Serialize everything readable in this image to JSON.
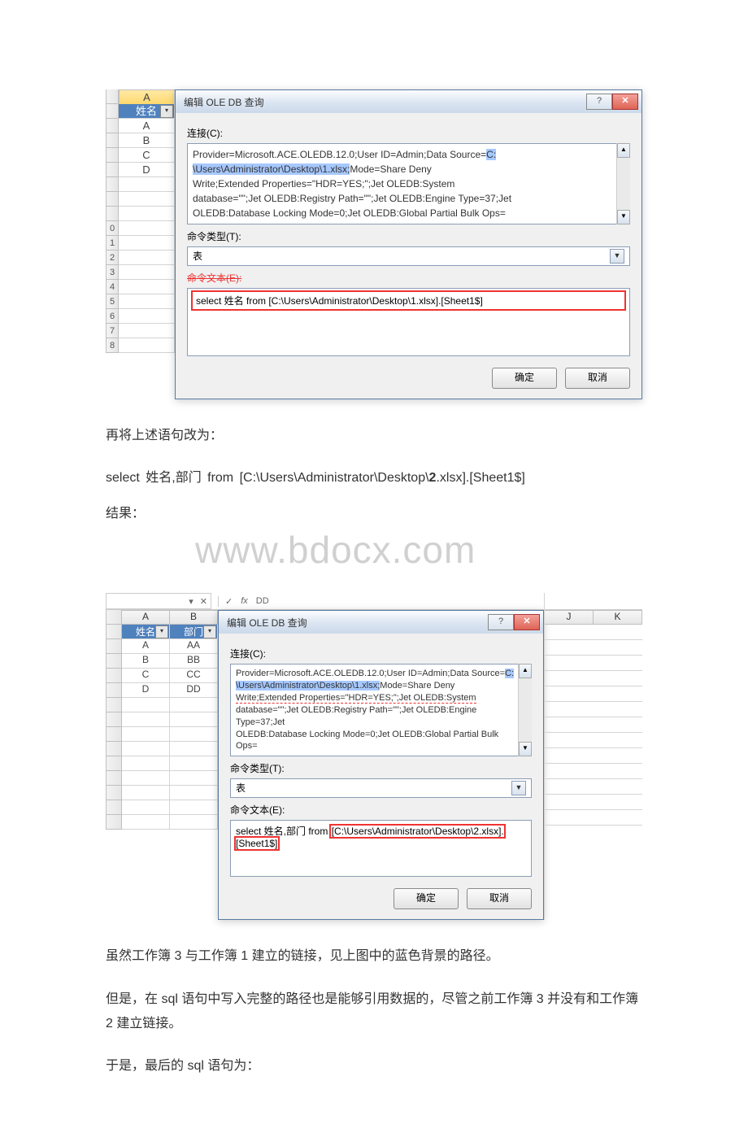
{
  "screenshot1": {
    "col_header": "A",
    "header_cell": "姓名",
    "rows": [
      "A",
      "B",
      "C",
      "D"
    ],
    "row_numbers": [
      "",
      "",
      "",
      "",
      "",
      "",
      "",
      "",
      "",
      "0",
      "1",
      "2",
      "3",
      "4",
      "5",
      "6",
      "7",
      "8"
    ],
    "dialog": {
      "title": "编辑 OLE DB 查询",
      "help_btn": "?",
      "close_btn": "✕",
      "conn_label": "连接(C):",
      "conn_text_pre": "Provider=Microsoft.ACE.OLEDB.12.0;User ID=Admin;Data Source=",
      "conn_hl1": "C:",
      "conn_line2_hl": "\\Users\\Administrator\\Desktop\\1.xlsx;",
      "conn_line2_rest": "Mode=Share Deny",
      "conn_line3": "Write;Extended Properties=\"HDR=YES;\";Jet OLEDB:System",
      "conn_line4": "database=\"\";Jet OLEDB:Registry Path=\"\";Jet OLEDB:Engine Type=37;Jet",
      "conn_line5": "OLEDB:Database Locking Mode=0;Jet OLEDB:Global Partial Bulk Ops=",
      "cmdtype_label": "命令类型(T):",
      "cmdtype_value": "表",
      "cmdtext_label_strike": "命令文本(E):",
      "sql": "select 姓名 from   [C:\\Users\\Administrator\\Desktop\\1.xlsx].[Sheet1$]",
      "ok": "确定",
      "cancel": "取消"
    }
  },
  "body": {
    "p1": "再将上述语句改为：",
    "code_pre": "select  姓名,部门  from    [C:\\Users\\Administrator\\Desktop\\",
    "code_bold": "2",
    "code_post": ".xlsx].[Sheet1$]",
    "result_label": "结果：",
    "watermark": "www.bdocx.com",
    "p2": "虽然工作簿 3 与工作簿 1 建立的链接，见上图中的蓝色背景的路径。",
    "p3": "但是，在 sql 语句中写入完整的路径也是能够引用数据的，尽管之前工作簿 3 并没有和工作簿 2 建立链接。",
    "p4": "于是，最后的 sql 语句为："
  },
  "screenshot2": {
    "formula_cell": "DD",
    "colA_label": "A",
    "colB_label": "B",
    "hdr1": "姓名",
    "hdr2": "部门",
    "colJ": "J",
    "colK": "K",
    "rows": [
      {
        "a": "A",
        "b": "AA"
      },
      {
        "a": "B",
        "b": "BB"
      },
      {
        "a": "C",
        "b": "CC"
      },
      {
        "a": "D",
        "b": "DD"
      }
    ],
    "dialog": {
      "title": "编辑 OLE DB 查询",
      "help_btn": "?",
      "close_btn": "✕",
      "conn_label": "连接(C):",
      "conn_text_pre": "Provider=Microsoft.ACE.OLEDB.12.0;User ID=Admin;Data Source=",
      "conn_hl1": "C:",
      "conn_line2_hl": "\\Users\\Administrator\\Desktop\\1.xlsx;",
      "conn_line2_rest": "Mode=Share Deny",
      "conn_line3": "Write;Extended Properties=\"HDR=YES;\";Jet OLEDB:System",
      "conn_line4": "database=\"\";Jet OLEDB:Registry Path=\"\";Jet OLEDB:Engine Type=37;Jet",
      "conn_line5": "OLEDB:Database Locking Mode=0;Jet OLEDB:Global Partial Bulk Ops=",
      "cmdtype_label": "命令类型(T):",
      "cmdtype_value": "表",
      "cmdtext_label": "命令文本(E):",
      "sql_pre": "select 姓名,部门 from  ",
      "sql_boxed": "[C:\\Users\\Administrator\\Desktop\\2.xlsx].[Sheet1$]",
      "ok": "确定",
      "cancel": "取消"
    }
  }
}
